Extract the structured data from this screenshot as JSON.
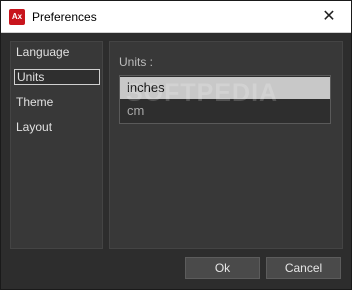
{
  "window": {
    "app_icon_text": "Ax",
    "title": "Preferences",
    "close_glyph": "✕"
  },
  "sidebar": {
    "items": [
      {
        "label": "Language",
        "selected": false
      },
      {
        "label": "Units",
        "selected": true
      },
      {
        "label": "Theme",
        "selected": false
      },
      {
        "label": "Layout",
        "selected": false
      }
    ]
  },
  "units_panel": {
    "label": "Units :",
    "options": [
      {
        "label": "inches",
        "selected": true
      },
      {
        "label": "cm",
        "selected": false
      }
    ]
  },
  "watermark": "SOFTPEDIA",
  "buttons": {
    "ok_label": "Ok",
    "cancel_label": "Cancel"
  },
  "colors": {
    "background": "#2d2d2d",
    "panel": "#383838",
    "selection": "#c8c8c8",
    "brand_red": "#c8141c"
  }
}
